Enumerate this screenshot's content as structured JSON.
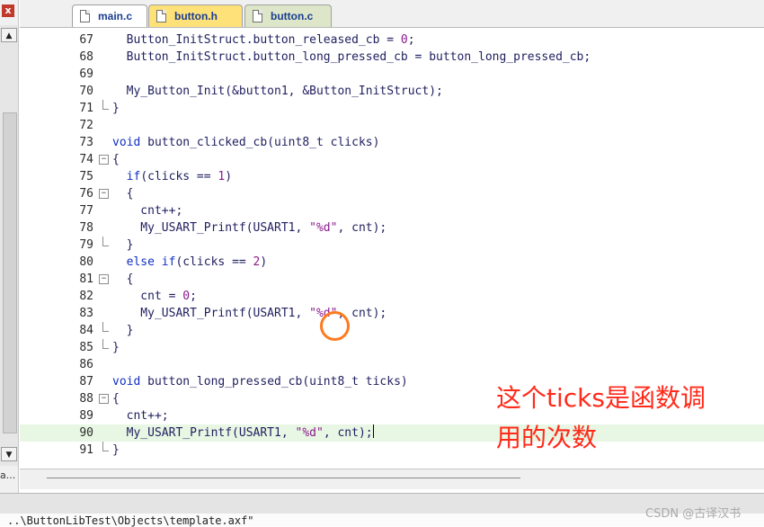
{
  "panel": {
    "close_glyph": "x",
    "left_label": "a..."
  },
  "tabs": [
    {
      "label": "main.c",
      "active": true,
      "color": "#ffffff"
    },
    {
      "label": "button.h",
      "active": false,
      "color": "#ffe17a"
    },
    {
      "label": "button.c",
      "active": false,
      "color": "#dde6c8"
    }
  ],
  "code": {
    "lines": [
      {
        "num": "67",
        "fold": "",
        "text": "  Button_InitStruct.button_released_cb = 0;"
      },
      {
        "num": "68",
        "fold": "",
        "text": "  Button_InitStruct.button_long_pressed_cb = button_long_pressed_cb;"
      },
      {
        "num": "69",
        "fold": "",
        "text": ""
      },
      {
        "num": "70",
        "fold": "",
        "text": "  My_Button_Init(&button1, &Button_InitStruct);"
      },
      {
        "num": "71",
        "fold": "end",
        "text": "}"
      },
      {
        "num": "72",
        "fold": "",
        "text": ""
      },
      {
        "num": "73",
        "fold": "",
        "text": "void button_clicked_cb(uint8_t clicks)"
      },
      {
        "num": "74",
        "fold": "open",
        "text": "{"
      },
      {
        "num": "75",
        "fold": "",
        "text": "  if(clicks == 1)"
      },
      {
        "num": "76",
        "fold": "open",
        "text": "  {"
      },
      {
        "num": "77",
        "fold": "",
        "text": "    cnt++;"
      },
      {
        "num": "78",
        "fold": "",
        "text": "    My_USART_Printf(USART1, \"%d\", cnt);"
      },
      {
        "num": "79",
        "fold": "end",
        "text": "  }"
      },
      {
        "num": "80",
        "fold": "",
        "text": "  else if(clicks == 2)"
      },
      {
        "num": "81",
        "fold": "open",
        "text": "  {"
      },
      {
        "num": "82",
        "fold": "",
        "text": "    cnt = 0;"
      },
      {
        "num": "83",
        "fold": "",
        "text": "    My_USART_Printf(USART1, \"%d\", cnt);"
      },
      {
        "num": "84",
        "fold": "end",
        "text": "  }"
      },
      {
        "num": "85",
        "fold": "end",
        "text": "}"
      },
      {
        "num": "86",
        "fold": "",
        "text": ""
      },
      {
        "num": "87",
        "fold": "",
        "text": "void button_long_pressed_cb(uint8_t ticks)"
      },
      {
        "num": "88",
        "fold": "open",
        "text": "{"
      },
      {
        "num": "89",
        "fold": "",
        "text": "  cnt++;"
      },
      {
        "num": "90",
        "fold": "",
        "text": "  My_USART_Printf(USART1, \"%d\", cnt);",
        "highlight": true,
        "cursor": true
      },
      {
        "num": "91",
        "fold": "end",
        "text": "}"
      }
    ]
  },
  "annotation": {
    "text": "这个ticks是函数调\n用的次数",
    "color": "#ff2a1a"
  },
  "output": {
    "text": "..\\ButtonLibTest\\Objects\\template.axf\""
  },
  "watermark": "CSDN @古译汉书",
  "colors": {
    "keyword": "#1030c0",
    "string": "#8a1a8a",
    "highlight": "#e8f6e4",
    "circle": "#ff7a1f"
  }
}
